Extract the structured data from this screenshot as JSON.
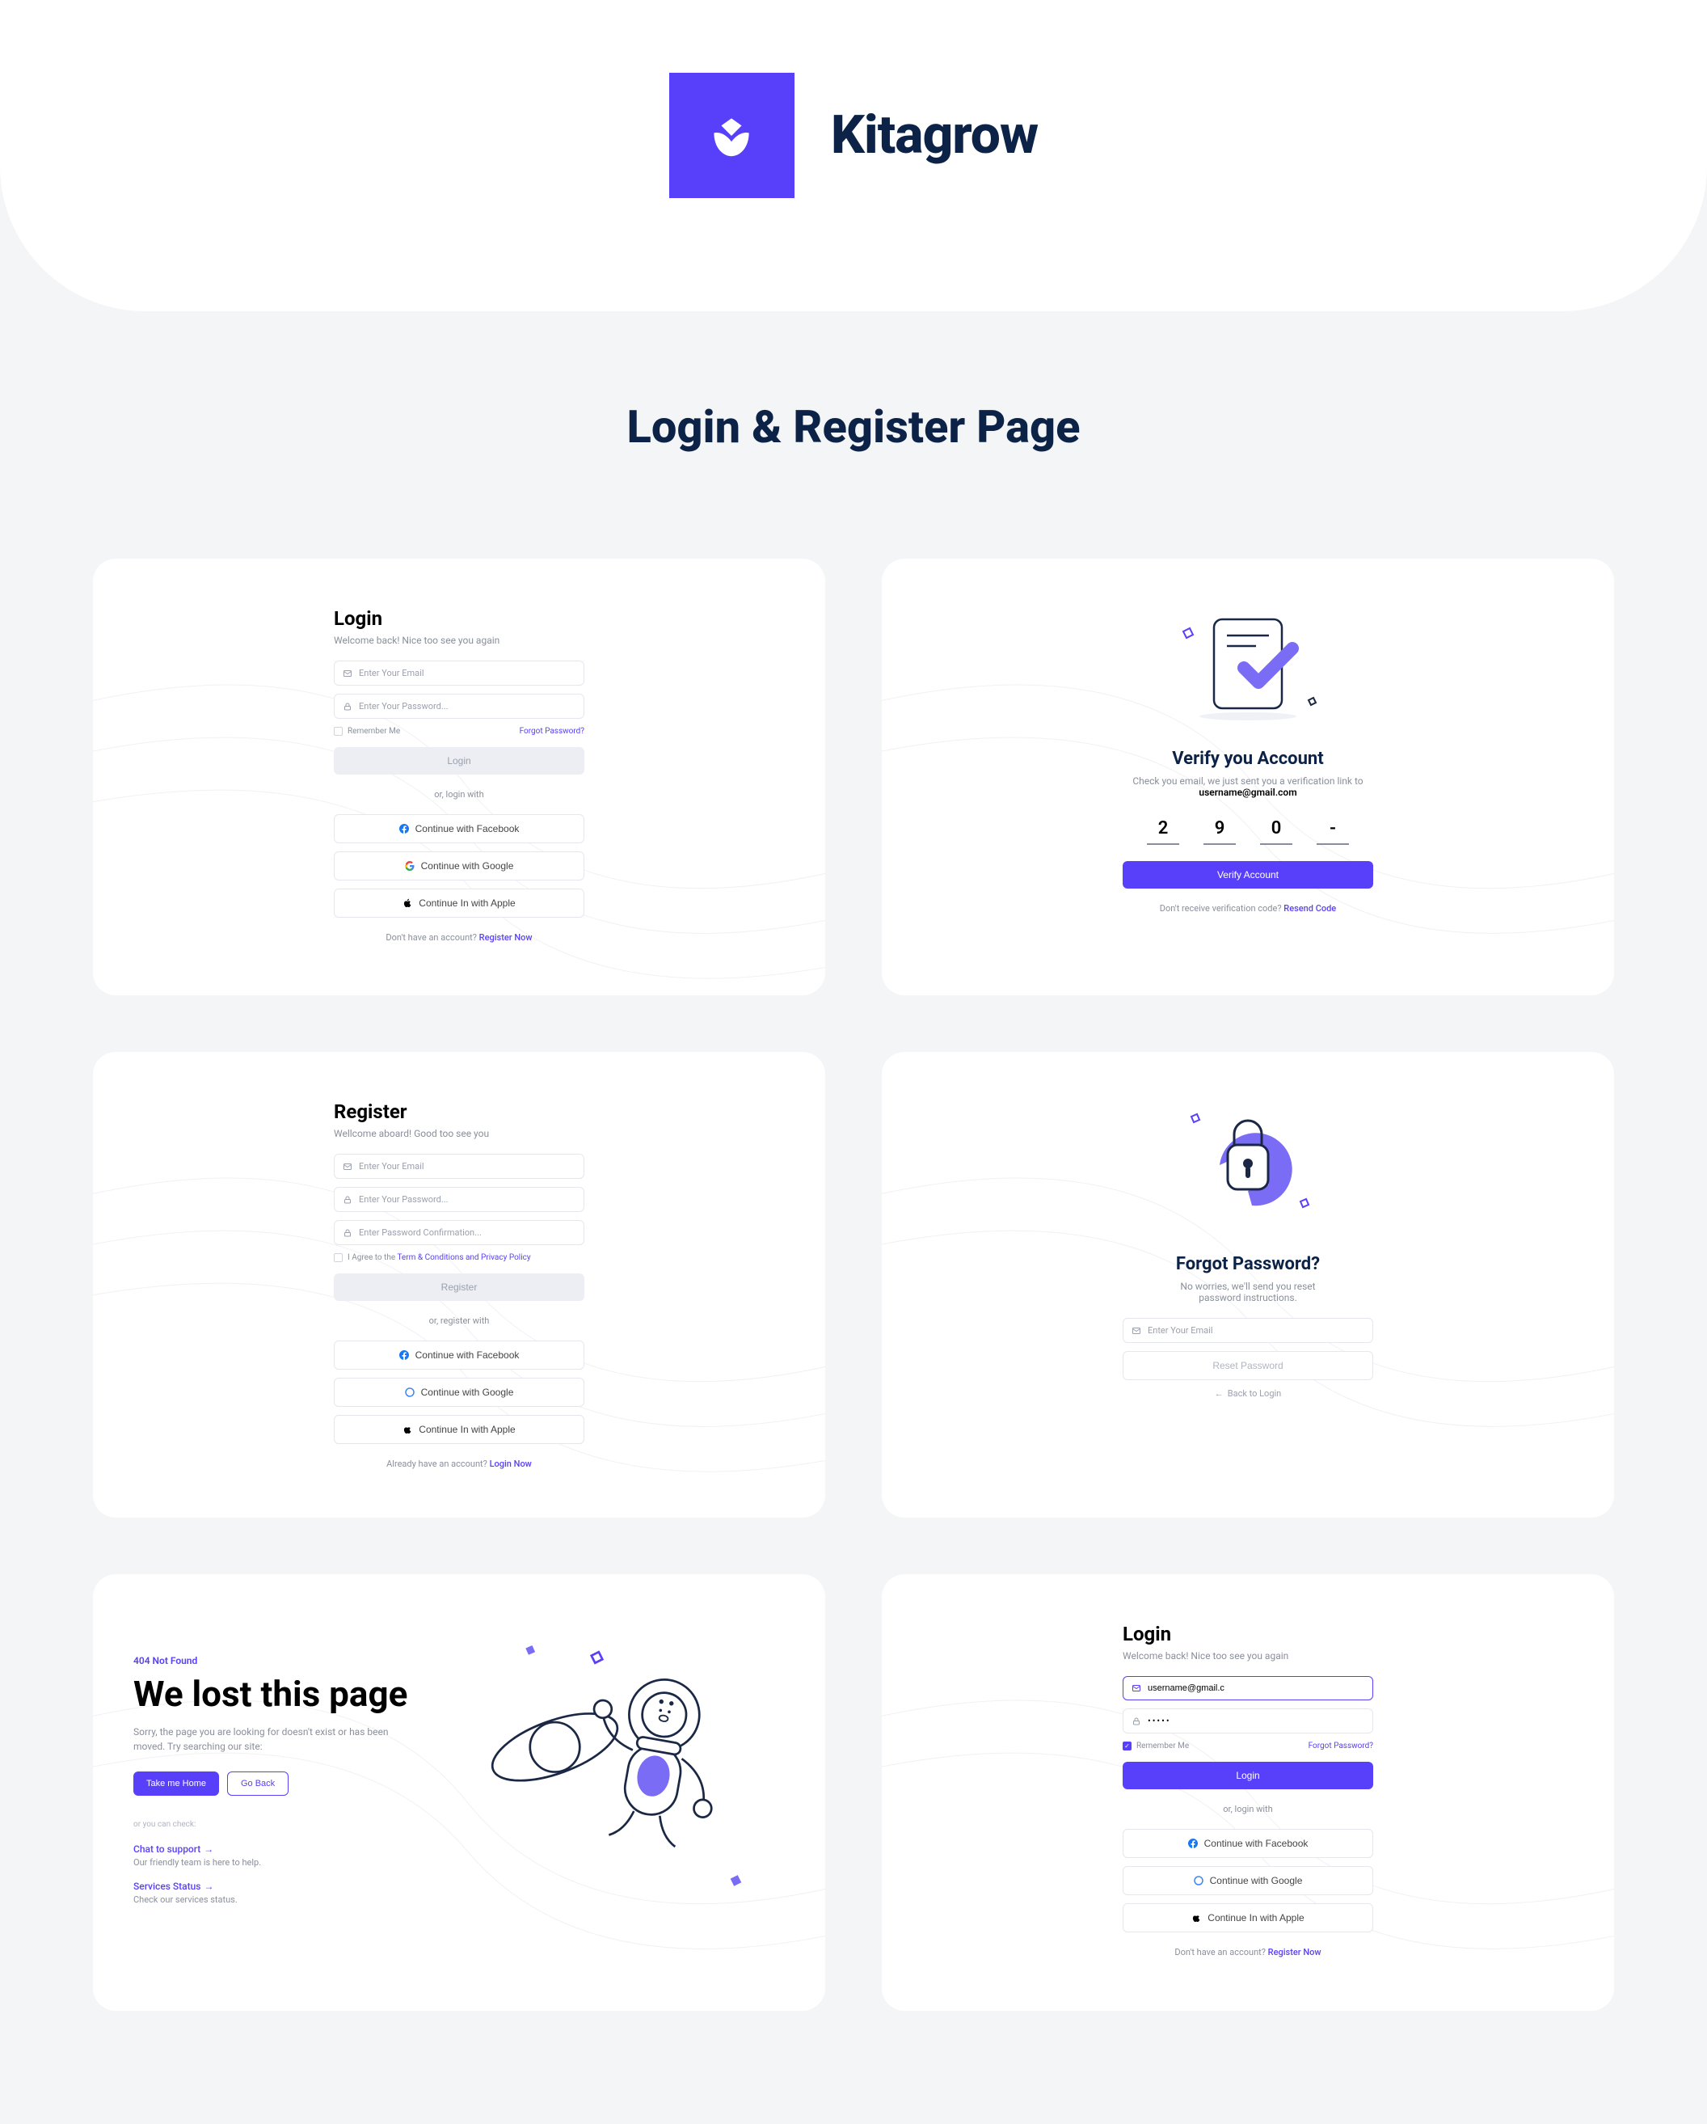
{
  "brand": {
    "name": "Kitagrow",
    "accent": "#5840FB"
  },
  "section_title": "Login & Register Page",
  "login": {
    "heading": "Login",
    "subheading": "Welcome back! Nice too see you again",
    "email_placeholder": "Enter Your Email",
    "password_placeholder": "Enter Your Password...",
    "remember_label": "Remember Me",
    "forgot_label": "Forgot Password?",
    "submit_label": "Login",
    "divider_label": "or, login with",
    "facebook_label": "Continue with Facebook",
    "google_label": "Continue with Google",
    "apple_label": "Continue In with Apple",
    "footer_text": "Don't have an account? ",
    "footer_link": "Register Now"
  },
  "verify": {
    "heading": "Verify you Account",
    "sub_prefix": "Check you email, we just sent you a verification link to ",
    "email": "username@gmail.com",
    "code": [
      "2",
      "9",
      "0",
      "-"
    ],
    "submit_label": "Verify Account",
    "footer_text": "Don't receive verification code? ",
    "footer_link": "Resend Code"
  },
  "register": {
    "heading": "Register",
    "subheading": "Wellcome aboard! Good too see you",
    "email_placeholder": "Enter Your Email",
    "password_placeholder": "Enter Your Password...",
    "confirm_placeholder": "Enter Password Confirmation...",
    "agree_prefix": "I Agree to the ",
    "agree_link": "Term & Conditions and Privacy Policy",
    "submit_label": "Register",
    "divider_label": "or, register with",
    "facebook_label": "Continue with Facebook",
    "google_label": "Continue with Google",
    "apple_label": "Continue In with Apple",
    "footer_text": "Already have an account? ",
    "footer_link": "Login Now"
  },
  "forgot": {
    "heading": "Forgot Password?",
    "subheading": "No worries, we'll send you reset password instructions.",
    "email_placeholder": "Enter Your Email",
    "submit_label": "Reset Password",
    "back_label": "Back to Login"
  },
  "notfound": {
    "tag": "404 Not Found",
    "heading": "We lost this page",
    "body": "Sorry, the page you are looking for doesn't exist or has been moved. Try searching our site:",
    "home_label": "Take me Home",
    "back_label": "Go Back",
    "or_label": "or you can check:",
    "support_title": "Chat to support",
    "support_desc": "Our friendly team is here to help.",
    "status_title": "Services Status",
    "status_desc": "Check our services status."
  },
  "login_active": {
    "heading": "Login",
    "subheading": "Welcome back! Nice too see you again",
    "email_value": "username@gmail.c",
    "password_value": "•••••",
    "remember_label": "Remember Me",
    "forgot_label": "Forgot Password?",
    "submit_label": "Login",
    "divider_label": "or, login with",
    "facebook_label": "Continue with Facebook",
    "google_label": "Continue with Google",
    "apple_label": "Continue In with Apple",
    "footer_text": "Don't have an account? ",
    "footer_link": "Register Now"
  }
}
